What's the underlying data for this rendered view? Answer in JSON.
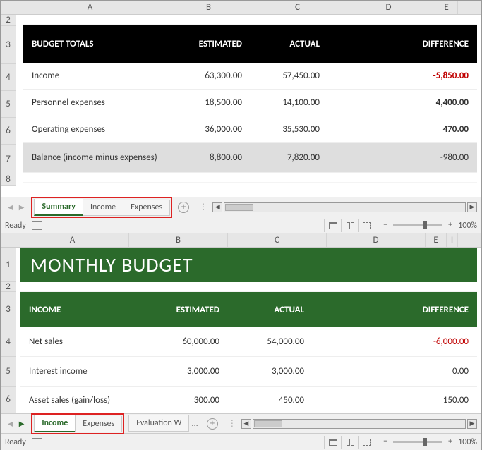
{
  "workbook1": {
    "columns": [
      "A",
      "B",
      "C",
      "D",
      "E"
    ],
    "rows": [
      "2",
      "3",
      "4",
      "5",
      "6",
      "7",
      "8"
    ],
    "header": {
      "title": "BUDGET TOTALS",
      "est": "ESTIMATED",
      "act": "ACTUAL",
      "diff": "DIFFERENCE"
    },
    "data": [
      {
        "label": "Income",
        "est": "63,300.00",
        "act": "57,450.00",
        "diff": "-5,850.00",
        "neg": true
      },
      {
        "label": "Personnel expenses",
        "est": "18,500.00",
        "act": "14,100.00",
        "diff": "4,400.00",
        "neg": false
      },
      {
        "label": "Operating expenses",
        "est": "36,000.00",
        "act": "35,530.00",
        "diff": "470.00",
        "neg": false
      }
    ],
    "balance": {
      "label": "Balance (income minus expenses)",
      "est": "8,800.00",
      "act": "7,820.00",
      "diff": "-980.00"
    },
    "tabs": [
      {
        "label": "Summary",
        "active": true
      },
      {
        "label": "Income",
        "active": false
      },
      {
        "label": "Expenses",
        "active": false
      }
    ]
  },
  "workbook2": {
    "columns": [
      "A",
      "B",
      "C",
      "D",
      "E",
      "I"
    ],
    "rows": [
      "1",
      "2",
      "3",
      "4",
      "5",
      "6"
    ],
    "title": "MONTHLY BUDGET",
    "header": {
      "title": "INCOME",
      "est": "ESTIMATED",
      "act": "ACTUAL",
      "diff": "DIFFERENCE"
    },
    "data": [
      {
        "label": "Net sales",
        "est": "60,000.00",
        "act": "54,000.00",
        "diff": "-6,000.00",
        "neg": true
      },
      {
        "label": "Interest income",
        "est": "3,000.00",
        "act": "3,000.00",
        "diff": "0.00",
        "neg": false
      },
      {
        "label": "Asset sales (gain/loss)",
        "est": "300.00",
        "act": "450.00",
        "diff": "150.00",
        "neg": false
      }
    ],
    "tabs": [
      {
        "label": "Income",
        "active": true
      },
      {
        "label": "Expenses",
        "active": false
      }
    ],
    "extra_tab": "Evaluation W"
  },
  "status": {
    "ready": "Ready",
    "zoom": "100%"
  }
}
